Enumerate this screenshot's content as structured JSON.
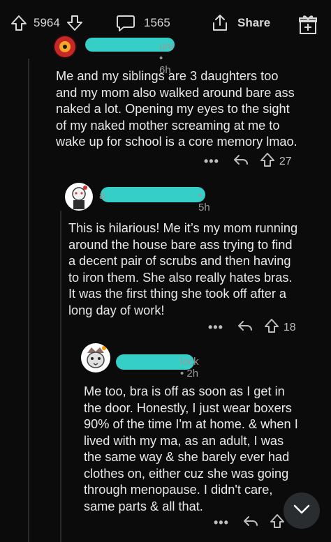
{
  "toolbar": {
    "upvotes": "5964",
    "comments": "1565",
    "share_label": "Share"
  },
  "comments": [
    {
      "username_fragment": "um",
      "age": "6h",
      "text": "Me and my siblings are 3 daughters too\nand my mom also walked around bare ass\nnaked a lot. Opening my eyes to the sight\nof my naked mother screaming at me to\nwake up for school is a core memory lmao.",
      "votes": "27"
    },
    {
      "username_fragment": "a",
      "age": "5h",
      "text": "This is hilarious! Me it’s my mom running\naround the house bare ass trying to find\na decent pair of scrubs and then having\nto iron them. She also really hates bras.\nIt was the first thing she took off after a\nlong day of work!",
      "votes": "18"
    },
    {
      "username_fragment": "lock",
      "age": "2h",
      "text": "Me too, bra is off as soon as I get in\nthe door. Honestly, I just wear boxers\n90% of the time I'm at home. & when I\nlived with my ma, as an adult, I was\nthe same way & she barely ever had\nclothes on, either cuz she was going\nthrough menopause. I didn't care,\nsame parts & all that.",
      "votes": ""
    }
  ],
  "colors": {
    "background": "#0b0b0b",
    "redaction": "#35cfc7",
    "text": "#e9e9e9",
    "meta": "#9a9a9a"
  },
  "icons": [
    "upvote-icon",
    "downvote-icon",
    "comment-icon",
    "share-icon",
    "award-icon",
    "more-icon",
    "reply-icon",
    "chevron-down-icon"
  ]
}
